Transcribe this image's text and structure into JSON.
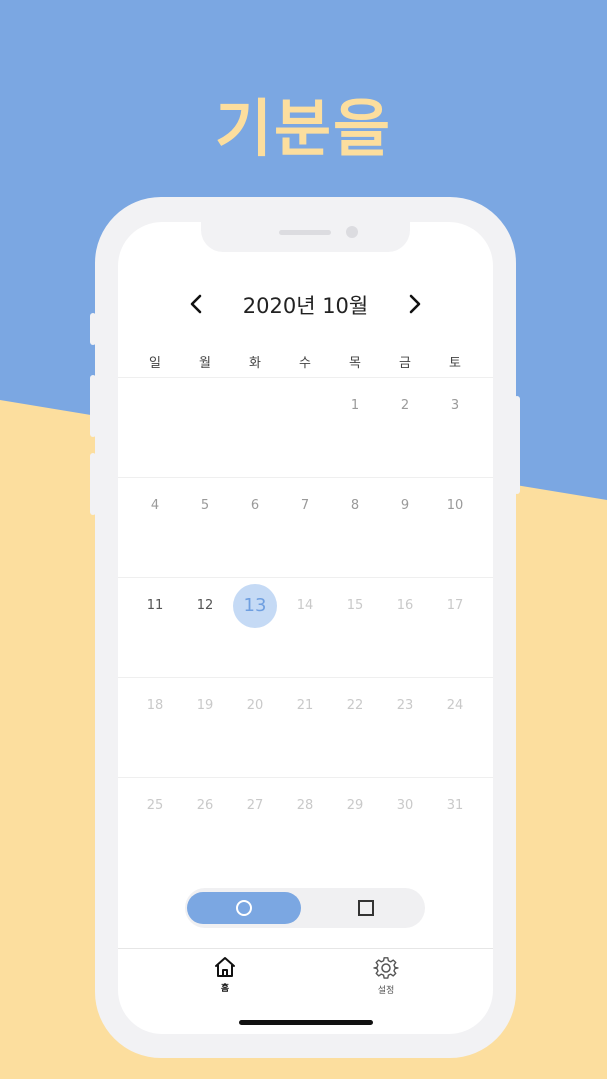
{
  "hero": {
    "title": "기분을"
  },
  "calendar": {
    "month_title": "2020년 10월",
    "prev_icon": "chevron-left-icon",
    "next_icon": "chevron-right-icon",
    "weekdays": [
      "일",
      "월",
      "화",
      "수",
      "목",
      "금",
      "토"
    ],
    "weeks": [
      [
        "",
        "",
        "",
        "",
        "1",
        "2",
        "3"
      ],
      [
        "4",
        "5",
        "6",
        "7",
        "8",
        "9",
        "10"
      ],
      [
        "11",
        "12",
        "13",
        "14",
        "15",
        "16",
        "17"
      ],
      [
        "18",
        "19",
        "20",
        "21",
        "22",
        "23",
        "24"
      ],
      [
        "25",
        "26",
        "27",
        "28",
        "29",
        "30",
        "31"
      ]
    ],
    "today": "13"
  },
  "view_toggle": {
    "options": [
      {
        "icon": "circle-icon",
        "selected": true
      },
      {
        "icon": "square-icon",
        "selected": false
      }
    ]
  },
  "tabbar": {
    "items": [
      {
        "label": "홈",
        "icon": "home-icon",
        "active": true
      },
      {
        "label": "설정",
        "icon": "gear-icon",
        "active": false
      }
    ]
  },
  "colors": {
    "accent_blue": "#7ba7e2",
    "accent_yellow": "#fcde9e",
    "today_fill": "#c5daf5"
  }
}
